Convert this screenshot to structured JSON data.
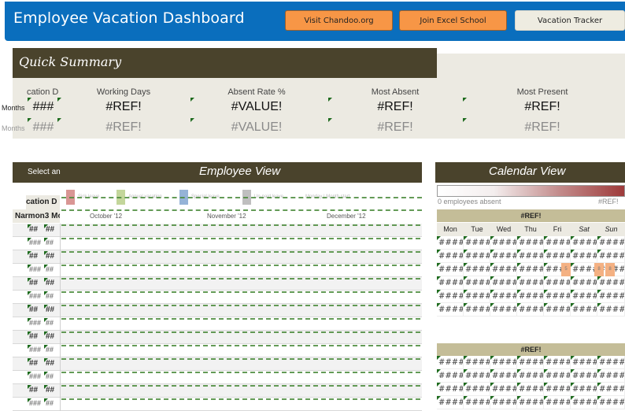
{
  "header": {
    "title": "Employee Vacation Dashboard",
    "buttons": [
      {
        "label": "Visit Chandoo.org",
        "style": "orange"
      },
      {
        "label": "Join Excel School",
        "style": "orange"
      },
      {
        "label": "Vacation Tracker",
        "style": "light"
      }
    ]
  },
  "quick_summary": {
    "title": "Quick Summary",
    "row_labels": [
      "Months",
      "Months"
    ],
    "columns": [
      {
        "label": "cation D",
        "value": "###",
        "prev_value": "###"
      },
      {
        "label": "Working Days",
        "value": "#REF!",
        "prev_value": "#REF!"
      },
      {
        "label": "Absent Rate %",
        "value": "#VALUE!",
        "prev_value": "#VALUE!"
      },
      {
        "label": "Most Absent",
        "value": "#REF!",
        "prev_value": "#REF!"
      },
      {
        "label": "Most Present",
        "value": "#REF!",
        "prev_value": "#REF!"
      }
    ]
  },
  "employee_view": {
    "title": "Employee View",
    "select_label": "Select an",
    "column_header_1": "cation D",
    "column_header_2": "Narmon3 Mo",
    "legend": [
      {
        "label": "Sick leave",
        "color": "#d99694"
      },
      {
        "label": "Annual vacation",
        "color": "#c3d69b"
      },
      {
        "label": "Special leave",
        "color": "#95b3d7"
      },
      {
        "label": "Un-paid leave",
        "color": "#bfbfbf"
      },
      {
        "label": "Monday | Month start",
        "color": ""
      }
    ],
    "months": [
      "October '12",
      "November '12",
      "December '12"
    ],
    "rows": [
      {
        "a": "##",
        "b": "##"
      },
      {
        "a": "###",
        "b": "##"
      },
      {
        "a": "##",
        "b": "##"
      },
      {
        "a": "###",
        "b": "##"
      },
      {
        "a": "##",
        "b": "##"
      },
      {
        "a": "###",
        "b": "##"
      },
      {
        "a": "##",
        "b": "##"
      },
      {
        "a": "###",
        "b": "##"
      },
      {
        "a": "##",
        "b": "##"
      },
      {
        "a": "###",
        "b": "##"
      },
      {
        "a": "##",
        "b": "##"
      },
      {
        "a": "###",
        "b": "##"
      },
      {
        "a": "##",
        "b": "##"
      },
      {
        "a": "###",
        "b": "##"
      }
    ]
  },
  "calendar_view": {
    "title": "Calendar View",
    "heat_min_label": "0 employees absent",
    "heat_max_label": "#REF!",
    "days_of_week": [
      "Mon",
      "Tue",
      "Wed",
      "Thu",
      "Fri",
      "Sat",
      "Sun"
    ],
    "months": [
      {
        "title": "#REF!",
        "weeks": 6,
        "cell": "####"
      },
      {
        "title": "#REF!",
        "weeks": 4,
        "cell": "####"
      }
    ],
    "highlights": [
      {
        "label": "5"
      },
      {
        "label": "8"
      },
      {
        "label": "8"
      }
    ]
  }
}
